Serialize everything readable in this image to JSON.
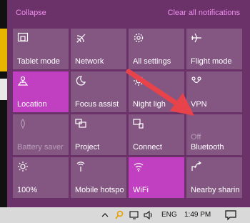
{
  "action_center": {
    "collapse_label": "Collapse",
    "clear_label": "Clear all notifications",
    "accent_color": "#c13fc1",
    "background_color": "#6a3268",
    "tiles": [
      {
        "label": "Tablet mode",
        "icon": "tablet-mode-icon",
        "state": "off"
      },
      {
        "label": "Network",
        "icon": "network-icon",
        "state": "off"
      },
      {
        "label": "All settings",
        "icon": "gear-icon",
        "state": "off"
      },
      {
        "label": "Flight mode",
        "icon": "airplane-icon",
        "state": "off"
      },
      {
        "label": "Location",
        "icon": "location-icon",
        "state": "on"
      },
      {
        "label": "Focus assist",
        "icon": "moon-icon",
        "state": "off"
      },
      {
        "label": "Night ligh",
        "icon": "brightness-icon",
        "state": "off"
      },
      {
        "label": "VPN",
        "icon": "vpn-icon",
        "state": "off"
      },
      {
        "label": "Battery saver",
        "icon": "battery-saver-icon",
        "state": "disabled"
      },
      {
        "label": "Project",
        "icon": "project-icon",
        "state": "off"
      },
      {
        "label": "Connect",
        "icon": "connect-icon",
        "state": "off"
      },
      {
        "label": "Bluetooth",
        "icon": "bluetooth-icon",
        "state": "off",
        "status": "Off"
      },
      {
        "label": "100%",
        "icon": "brightness-icon",
        "state": "off"
      },
      {
        "label": "Mobile hotspot",
        "icon": "hotspot-icon",
        "state": "off"
      },
      {
        "label": "WiFi",
        "icon": "wifi-icon",
        "state": "on"
      },
      {
        "label": "Nearby sharing",
        "icon": "share-icon",
        "state": "off"
      }
    ]
  },
  "taskbar": {
    "language": "ENG",
    "time": "1:49 PM",
    "tray_icons": [
      "chevron-up-icon",
      "search-key-icon",
      "network-icon",
      "speaker-icon"
    ],
    "notification_icon": "notification-icon"
  }
}
